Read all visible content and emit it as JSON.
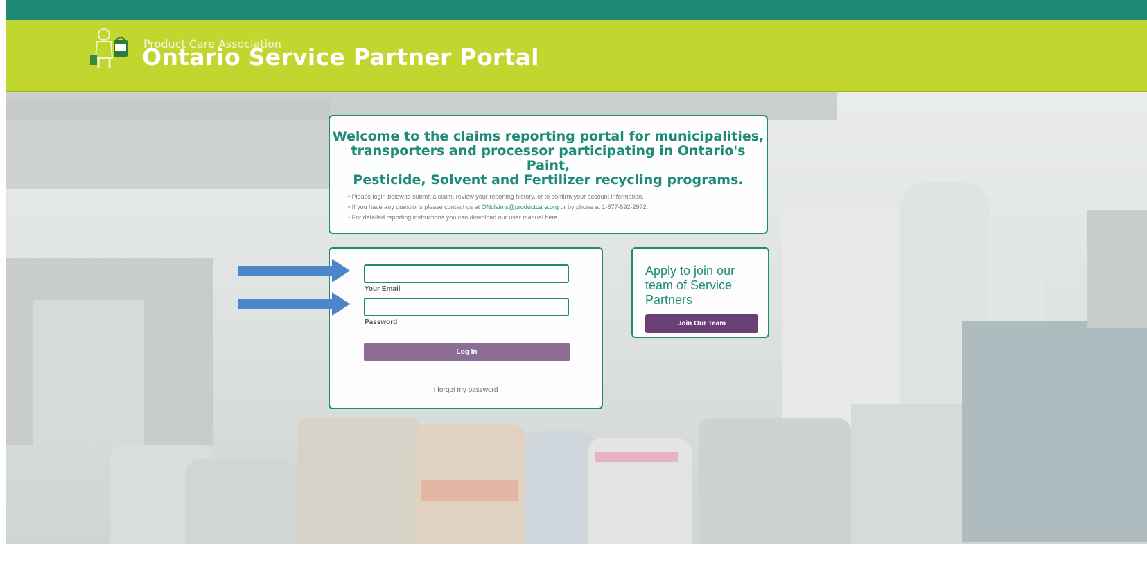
{
  "header": {
    "org_name": "Product Care Association",
    "portal_title": "Ontario Service Partner Portal"
  },
  "welcome": {
    "heading_lines": [
      "Welcome to the claims reporting portal for municipalities,",
      "transporters and processor participating in Ontario's Paint,",
      "Pesticide, Solvent and Fertilizer recycling programs."
    ],
    "bullet_1": "Please login below to submit a claim, review your reporting history, or to confirm your account information.",
    "bullet_2_pre": "If you have any questions please contact us at ",
    "bullet_2_link": "ONclaims@productcare.org",
    "bullet_2_post": " or by phone at 1-877-592-2972.",
    "bullet_3": "For detailed reporting instructions you can download our user manual here."
  },
  "login": {
    "email_value": "",
    "email_label": "Your Email",
    "password_value": "",
    "password_label": "Password",
    "login_button": "Log In",
    "forgot_link": "I forgot my password"
  },
  "apply": {
    "text": "Apply to join our team of Service Partners",
    "button": "Join Our Team"
  },
  "colors": {
    "top_strip": "#1f8b76",
    "header": "#c1d72f",
    "accent_teal": "#1f8b76",
    "login_button": "#8c6e95",
    "join_button": "#6a3f75",
    "annotation_arrow": "#4a86c8"
  },
  "icons": {
    "logo": "paint-can-mascot-icon",
    "annotation": "arrow-right-icon"
  }
}
